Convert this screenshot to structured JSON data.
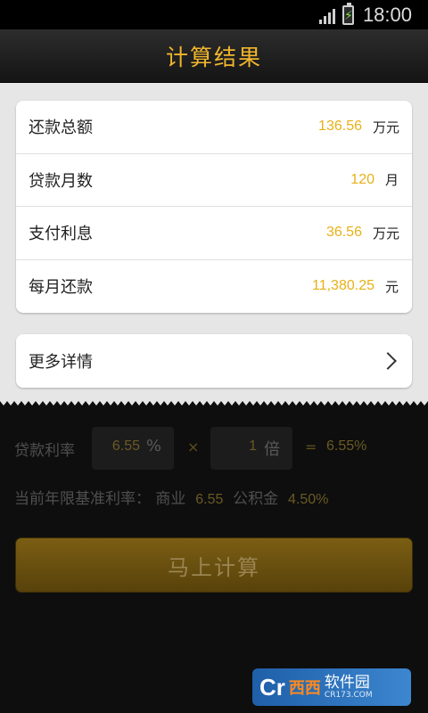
{
  "status_bar": {
    "time": "18:00",
    "signal_icon": "signal-icon",
    "battery_icon": "battery-charging-icon"
  },
  "header": {
    "title": "计算结果"
  },
  "results": [
    {
      "label": "还款总额",
      "value": "136.56",
      "unit": "万元"
    },
    {
      "label": "贷款月数",
      "value": "120",
      "unit": "月"
    },
    {
      "label": "支付利息",
      "value": "36.56",
      "unit": "万元"
    },
    {
      "label": "每月还款",
      "value": "11,380.25",
      "unit": "元"
    }
  ],
  "more": {
    "label": "更多详情",
    "icon": "chevron-right-icon"
  },
  "rate": {
    "label": "贷款利率",
    "base_value": "6.55",
    "percent_sign": "%",
    "times_sign": "×",
    "multiplier": "1",
    "multiplier_unit": "倍",
    "equals_sign": "=",
    "result": "6.55%"
  },
  "base_rates": {
    "label": "当前年限基准利率：",
    "commercial_label": "商业",
    "commercial_value": "6.55",
    "fund_label": "公积金",
    "fund_value": "4.50%"
  },
  "calculate_button": {
    "label": "马上计算"
  },
  "watermark": {
    "logo": "Cr",
    "brand": "西西",
    "text": "软件园",
    "domain": "CR173.COM"
  },
  "colors": {
    "accent": "#e8b017",
    "title": "#f0b52d",
    "button": "#6a5010"
  }
}
